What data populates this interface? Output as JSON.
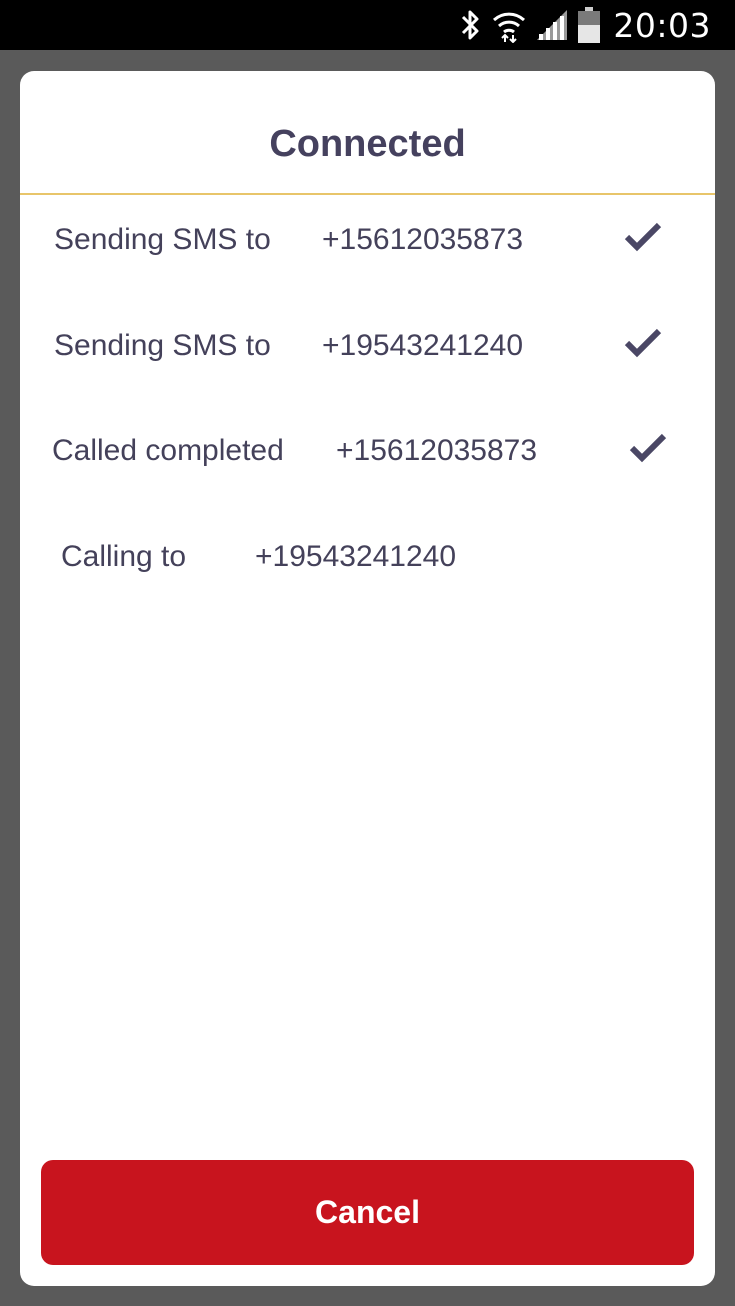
{
  "status_bar": {
    "time": "20:03",
    "icons": [
      "bluetooth-icon",
      "wifi-icon",
      "signal-icon",
      "battery-icon"
    ]
  },
  "dialog": {
    "title": "Connected",
    "log": [
      {
        "label": "Sending SMS to",
        "number": "+15612035873",
        "completed": true
      },
      {
        "label": "Sending SMS to",
        "number": "+19543241240",
        "completed": true
      },
      {
        "label": "Called completed",
        "number": "+15612035873",
        "completed": true
      },
      {
        "label": "Calling to",
        "number": "+19543241240",
        "completed": false
      }
    ],
    "cancel_label": "Cancel"
  },
  "colors": {
    "overlay": "#5a5a5a",
    "title_text": "#45415e",
    "divider": "#e8c56a",
    "check": "#4a4765",
    "cancel_button": "#c8141e"
  }
}
